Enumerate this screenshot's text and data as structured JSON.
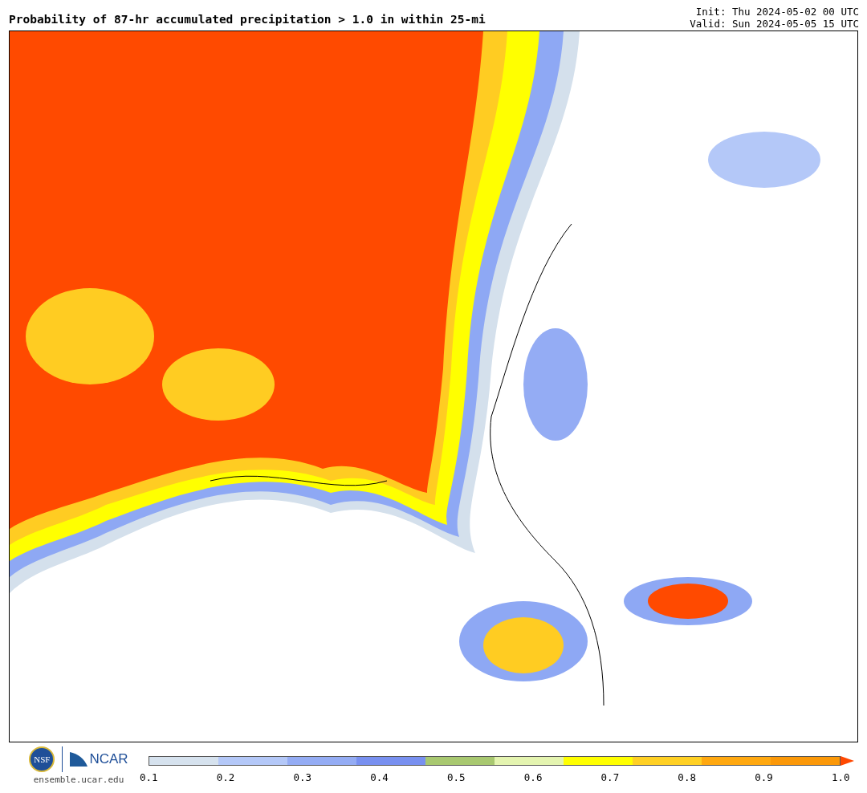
{
  "header": {
    "title": "Probability of 87-hr accumulated precipitation > 1.0 in within 25-mi",
    "init": "Init: Thu 2024-05-02 00 UTC",
    "valid": "Valid: Sun 2024-05-05 15 UTC"
  },
  "footer": {
    "logo_left": "NSF",
    "logo_right": "NCAR",
    "site": "ensemble.ucar.edu"
  },
  "colorbar": {
    "segments": [
      {
        "color": "#d6e2ee"
      },
      {
        "color": "#b4c8f8"
      },
      {
        "color": "#94acf4"
      },
      {
        "color": "#7890f0"
      },
      {
        "color": "#a8c870"
      },
      {
        "color": "#e4f4b0"
      },
      {
        "color": "#ffff00"
      },
      {
        "color": "#ffd024"
      },
      {
        "color": "#ffa810"
      },
      {
        "color": "#fb9808"
      }
    ],
    "arrow": {
      "color": "#ff4800"
    },
    "ticks": [
      "0.1",
      "0.2",
      "0.3",
      "0.4",
      "0.5",
      "0.6",
      "0.7",
      "0.8",
      "0.9",
      "1.0"
    ]
  }
}
